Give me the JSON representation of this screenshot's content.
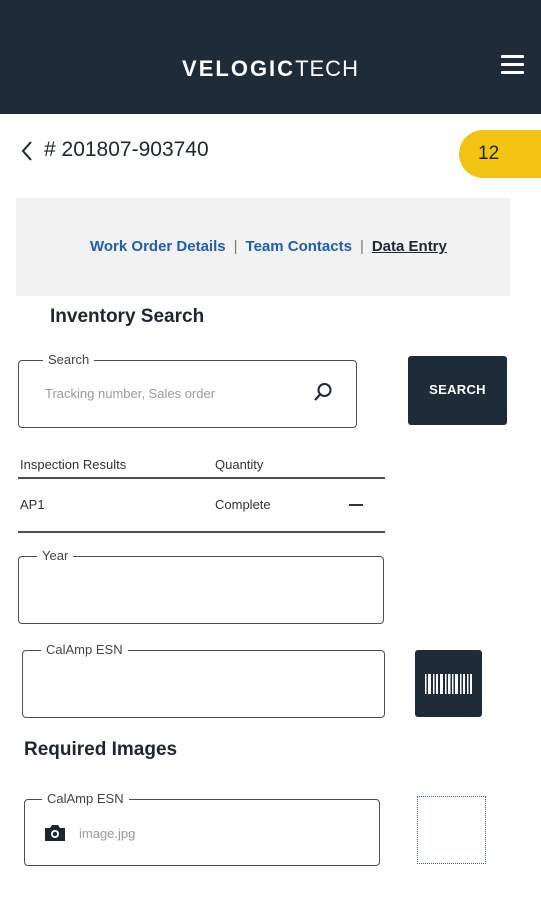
{
  "header": {
    "brand_bold": "VELOGIC",
    "brand_light": "TECH",
    "menu_icon": "hamburger-menu-icon"
  },
  "order": {
    "back_icon": "chevron-left-icon",
    "number": "# 201807-903740",
    "badge": "12",
    "badge_color": "#f2c313"
  },
  "tabs": [
    {
      "label": "Work Order Details",
      "active": false
    },
    {
      "label": "Team Contacts",
      "active": false
    },
    {
      "label": "Data Entry",
      "active": true
    }
  ],
  "inventory": {
    "title": "Inventory Search",
    "search_legend": "Search",
    "search_placeholder": "Tracking number, Sales order",
    "search_icon": "magnifier-icon",
    "search_button": "SEARCH"
  },
  "results": {
    "columns": [
      "Inspection Results",
      "Quantity"
    ],
    "rows": [
      {
        "name": "AP1",
        "quantity": "Complete"
      }
    ]
  },
  "form": {
    "year_legend": "Year",
    "esn_legend": "CalAmp ESN",
    "barcode_icon": "barcode-icon"
  },
  "images": {
    "title": "Required Images",
    "esn_legend": "CalAmp ESN",
    "camera_icon": "camera-icon",
    "file_placeholder": "image.jpg"
  },
  "colors": {
    "primary_dark": "#1e2b38",
    "accent_yellow": "#f2c313",
    "link_blue": "#1f5fb0"
  }
}
